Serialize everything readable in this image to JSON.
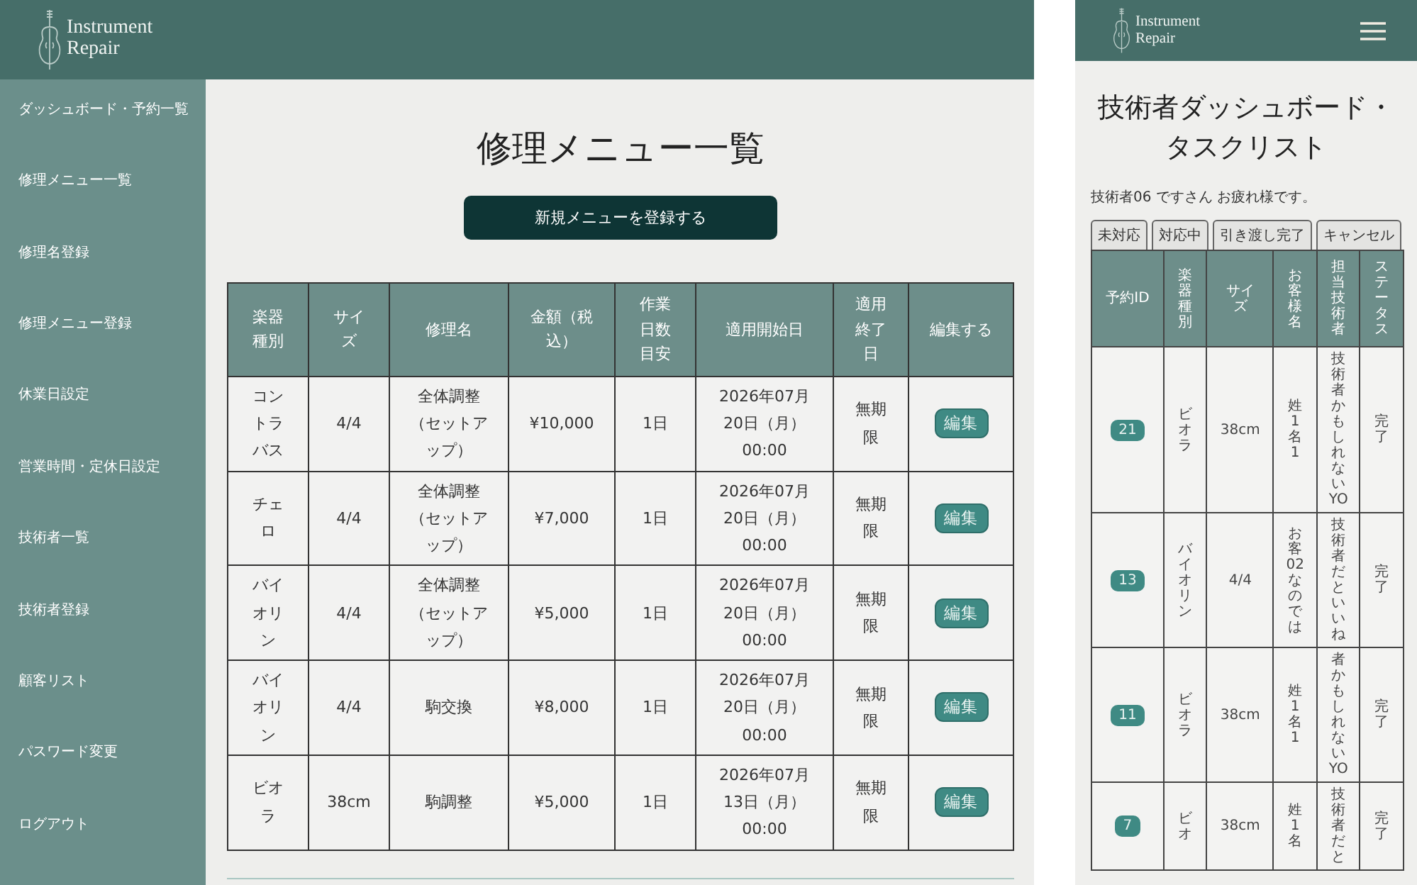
{
  "logo": {
    "line1": "Instrument",
    "line2": "Repair"
  },
  "admin": {
    "sidebar": [
      {
        "label": "ダッシュボード・予約一覧"
      },
      {
        "label": "修理メニュー一覧"
      },
      {
        "label": "修理名登録"
      },
      {
        "label": "修理メニュー登録"
      },
      {
        "label": "休業日設定"
      },
      {
        "label": "営業時間・定休日設定"
      },
      {
        "label": "技術者一覧"
      },
      {
        "label": "技術者登録"
      },
      {
        "label": "顧客リスト"
      },
      {
        "label": "パスワード変更"
      },
      {
        "label": "ログアウト"
      }
    ],
    "title": "修理メニュー一覧",
    "new_button": "新規メニューを登録する",
    "table": {
      "columns": [
        "楽器種別",
        "サイズ",
        "修理名",
        "金額（税込）",
        "作業日数目安",
        "適用開始日",
        "適用終了日",
        "編集する"
      ],
      "rows": [
        {
          "cells": [
            "コントラバス",
            "4/4",
            "全体調整（セットアップ）",
            "¥10,000",
            "1日",
            "2026年07月20日（月）00:00",
            "無期限"
          ],
          "action": "編集"
        },
        {
          "cells": [
            "チェロ",
            "4/4",
            "全体調整（セットアップ）",
            "¥7,000",
            "1日",
            "2026年07月20日（月）00:00",
            "無期限"
          ],
          "action": "編集"
        },
        {
          "cells": [
            "バイオリン",
            "4/4",
            "全体調整（セットアップ）",
            "¥5,000",
            "1日",
            "2026年07月20日（月）00:00",
            "無期限"
          ],
          "action": "編集"
        },
        {
          "cells": [
            "バイオリン",
            "4/4",
            "駒交換",
            "¥8,000",
            "1日",
            "2026年07月20日（月）00:00",
            "無期限"
          ],
          "action": "編集"
        },
        {
          "cells": [
            "ビオラ",
            "38cm",
            "駒調整",
            "¥5,000",
            "1日",
            "2026年07月13日（月）00:00",
            "無期限"
          ],
          "action": "編集"
        }
      ]
    }
  },
  "mobile": {
    "logo": {
      "line1": "Instrument",
      "line2": "Repair"
    },
    "title": "技術者ダッシュボード・タスクリスト",
    "greeting": "技術者06 ですさん お疲れ様です。",
    "tabs": [
      {
        "label": "未対応"
      },
      {
        "label": "対応中"
      },
      {
        "label": "引き渡し完了"
      },
      {
        "label": "キャンセル"
      }
    ],
    "table": {
      "columns": [
        "予約ID",
        "楽器種別",
        "サイズ",
        "お客様名",
        "担当技術者",
        "ステータス"
      ],
      "rows": [
        {
          "cells": [
            "21",
            "ビオラ",
            "38cm",
            "姓1名1",
            "技術者かもしれないYO",
            "完了"
          ]
        },
        {
          "cells": [
            "13",
            "バイオリン",
            "4/4",
            "お客02なのでは",
            "技術者だといいね",
            "完了"
          ]
        },
        {
          "cells": [
            "11",
            "ビオラ",
            "38cm",
            "姓1名1",
            "者かもしれないYO",
            "完了"
          ]
        },
        {
          "cells": [
            "7",
            "ビオ",
            "38cm",
            "姓1名",
            "技術者だと",
            "完了"
          ]
        }
      ]
    }
  }
}
